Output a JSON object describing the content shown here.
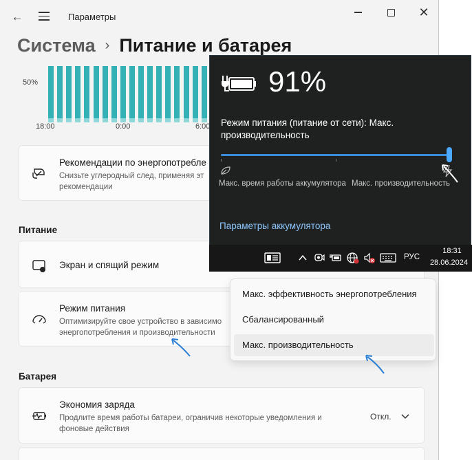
{
  "window": {
    "app_title": "Параметры",
    "breadcrumb_parent": "Система",
    "breadcrumb_separator": "›",
    "page_title": "Питание и батарея"
  },
  "chart_data": {
    "type": "bar",
    "y_tick_label": "50%",
    "x_tick_labels": [
      "18:00",
      "0:00",
      "6:00"
    ],
    "values_percent": [
      100,
      100,
      100,
      100,
      100,
      100,
      100,
      100,
      100,
      100,
      100,
      100,
      100,
      100,
      100,
      100,
      100,
      100,
      100,
      100,
      100,
      100,
      100
    ],
    "color": "#34b1b4"
  },
  "cards": {
    "recommendations": {
      "title": "Рекомендации по энергопотребле",
      "desc_line1": "Снизьте углеродный след, применяя эт",
      "desc_line2": "рекомендации"
    },
    "power_section": "Питание",
    "screen_sleep": {
      "title": "Экран и спящий режим"
    },
    "power_mode": {
      "title": "Режим питания",
      "desc_line1": "Оптимизируйте свое устройство в зависимо",
      "desc_line2": "энергопотребления и производительности"
    },
    "battery_section": "Батарея",
    "battery_saver": {
      "title": "Экономия заряда",
      "desc_line1": "Продлите время работы батареи, ограничив некоторые уведомления и",
      "desc_line2": "фоновые действия",
      "status": "Откл."
    }
  },
  "flyout": {
    "battery_percent": "91%",
    "mode_text": "Режим питания (питание от сети): Макс. производительность",
    "slider_value_fraction": 1.0,
    "left_label": "Макс. время работы аккумулятора",
    "right_label": "Макс. производительность",
    "settings_link": "Параметры аккумулятора",
    "accent_color": "#4aa8ff"
  },
  "taskbar": {
    "language": "РУС",
    "time": "18:31",
    "date": "28.06.2024"
  },
  "dropdown": {
    "options": [
      "Макс. эффективность энергопотребления",
      "Сбалансированный",
      "Макс. производительность"
    ],
    "selected": "Макс. производительность"
  }
}
